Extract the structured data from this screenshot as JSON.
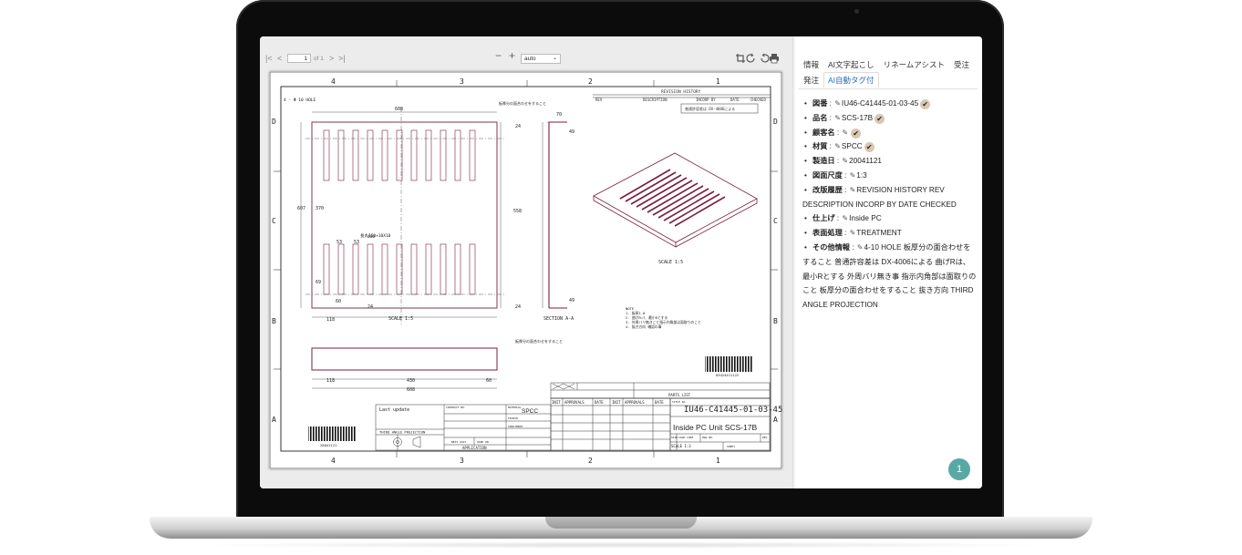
{
  "toolbar": {
    "first_page": "|<",
    "prev_page": "<",
    "page_current": "1",
    "page_of": "of 1",
    "next_page": ">",
    "last_page": ">|",
    "zoom_out": "−",
    "zoom_in": "+",
    "zoom_value": "auto"
  },
  "drawing": {
    "top_labels": [
      "4",
      "3",
      "2",
      "1"
    ],
    "side_labels": [
      "D",
      "C",
      "B",
      "A"
    ],
    "revision_title": "REVISION HISTORY",
    "rev_headers": [
      "REV",
      "DESCRIPTION",
      "INCORP BY",
      "DATE",
      "CHECKED"
    ],
    "note_box": "普通許容差は DX-4006による",
    "hole_note": "4 - Φ 10 HOLE",
    "slot_note": "長丸150×10X10",
    "face_note_top": "板厚分の面合わせをすること",
    "face_note_bottom": "板厚分の面合わせをすること",
    "dims": {
      "top_width": "608",
      "height": "607",
      "inner_height": "370",
      "gap1": "53",
      "gap2": "53",
      "d69": "69",
      "d60": "60",
      "d24": "24",
      "d118": "118",
      "d400": "400",
      "side_70": "70",
      "side_49a": "49",
      "side_49b": "49",
      "side_558": "558",
      "side_24a": "24",
      "side_24b": "24",
      "bottom_118": "118",
      "bottom_430": "430",
      "bottom_60": "60",
      "bottom_608": "608"
    },
    "scale_view": "SCALE 1:5",
    "scale_label": "SCALE 1:5",
    "section": "SECTION A-A",
    "notes": [
      "NOTE",
      "1. 板厚1.0",
      "2. 曲げR=T、最小Rとする",
      "3. 外周バリ無きこと指示内角部は面取りのこと",
      "4. 抜き方向 確認の事"
    ],
    "barcode_number": "03424411122",
    "parts_list": "PARTS LIST",
    "approvals": [
      "INIT",
      "APPROVALS",
      "DATE",
      "INIT",
      "APPROVALS",
      "DATE"
    ],
    "last_update": "Last update",
    "material_label": "MATERIAL",
    "material_value": "SPCC",
    "finish_label": "FINISH",
    "treatment_label": "TREATMENT",
    "contract_label": "CONTRACT NO.",
    "third_angle": "THIRD ANGLE PROJECTION",
    "application": "APPLICATION",
    "next_assy": "NEXT ASSY",
    "used_on": "USED ON",
    "title_small": "TITLE No.",
    "drawing_number": "IU46-C41445-01-03-45",
    "drawing_title": "Inside PC Unit SCS-17B",
    "size": "SIZE",
    "cage_code": "CAGE CODE",
    "dwg_no": "DWG NO.",
    "rev": "REV",
    "scale_cell": "SCALE 1:3",
    "sheet": "SHEET",
    "barcode_left_number": "20041121"
  },
  "panel": {
    "tabs": [
      "情報",
      "AI文字起こし",
      "リネームアシスト",
      "受注",
      "発注",
      "AI自動タグ付"
    ],
    "active_tab_index": 5,
    "fields": [
      {
        "label": "図番",
        "value": "IU46-C41445-01-03-45",
        "checked": true
      },
      {
        "label": "品名",
        "value": "SCS-17B",
        "checked": true
      },
      {
        "label": "顧客名",
        "value": "",
        "checked": true
      },
      {
        "label": "材質",
        "value": "SPCC",
        "checked": true
      },
      {
        "label": "製造日",
        "value": "20041121",
        "checked": false
      },
      {
        "label": "図面尺度",
        "value": "1:3",
        "checked": false
      },
      {
        "label": "改版履歴",
        "value": "REVISION HISTORY REV DESCRIPTION INCORP BY DATE CHECKED",
        "checked": false
      },
      {
        "label": "仕上げ",
        "value": "Inside PC",
        "checked": false
      },
      {
        "label": "表面処理",
        "value": "TREATMENT",
        "checked": false
      },
      {
        "label": "その他情報",
        "value": "4-10 HOLE 板厚分の面合わせをすること 普通許容差は DX-4006による 曲げRは、最小Rとする 外周バリ無き事 指示内角部は面取りのこと 板厚分の面合わせをすること 抜き方向 THIRD ANGLE PROJECTION",
        "checked": false
      }
    ],
    "fab_label": "1"
  },
  "colors": {
    "accent": "#2a6fb8",
    "check_badge": "#d9c7b0",
    "fab": "#5aa8a4",
    "drawing_part": "#7a1f3d"
  }
}
